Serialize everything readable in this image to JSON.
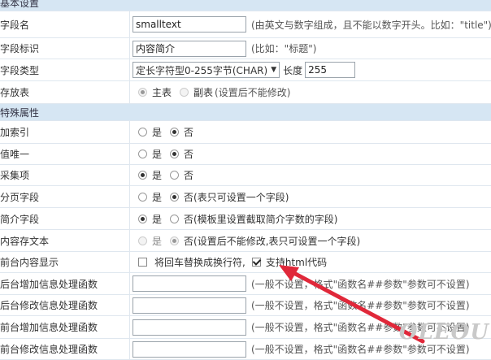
{
  "sections": {
    "basic": "基本设置",
    "special": "特殊属性"
  },
  "fields": {
    "field_name": {
      "label": "字段名",
      "value": "smalltext",
      "hint": "(由英文与数字组成，且不能以数字开头。比如：\"title\")"
    },
    "field_id": {
      "label": "字段标识",
      "value": "内容简介",
      "hint": "(比如：\"标题\")"
    },
    "field_type": {
      "label": "字段类型",
      "selected": "定长字符型0-255字节(CHAR)",
      "length_label": "长度",
      "length_value": "255"
    },
    "store_table": {
      "label": "存放表",
      "opt_main": "主表",
      "opt_sub": "副表",
      "hint": "(设置后不能修改)"
    }
  },
  "special": {
    "index": {
      "label": "加索引",
      "yes": "是",
      "no": "否"
    },
    "unique": {
      "label": "值唯一",
      "yes": "是",
      "no": "否"
    },
    "collect": {
      "label": "采集项",
      "yes": "是",
      "no": "否"
    },
    "page_field": {
      "label": "分页字段",
      "yes": "是",
      "no": "否(表只可设置一个字段)"
    },
    "summary_field": {
      "label": "简介字段",
      "yes": "是",
      "no": "否(模板里设置截取简介字数的字段)"
    },
    "content_text": {
      "label": "内容存文本",
      "yes": "是",
      "no": "否(设置后不能修改,表只可设置一个字段)"
    },
    "front_display": {
      "label": "前台内容显示",
      "opt_br": "将回车替换成换行符,",
      "opt_html": "支持html代码"
    },
    "bg_add_func": {
      "label": "后台增加信息处理函数",
      "hint": "(一般不设置，格式\"函数名##参数\"参数可不设置)"
    },
    "bg_edit_func": {
      "label": "后台修改信息处理函数",
      "hint": "(一般不设置，格式\"函数名##参数\"参数可不设置)"
    },
    "fg_add_func": {
      "label": "前台增加信息处理函数",
      "hint": "(一般不设置，格式\"函数名##参数\"参数可不设置)"
    },
    "fg_edit_func": {
      "label": "前台修改信息处理函数",
      "hint": "(一般不设置，格式\"函数名##参数\"参数可不设置)"
    }
  },
  "watermark": "OLEOU",
  "colors": {
    "section_bg": "#d6e6f3",
    "arrow": "#e0283a"
  }
}
